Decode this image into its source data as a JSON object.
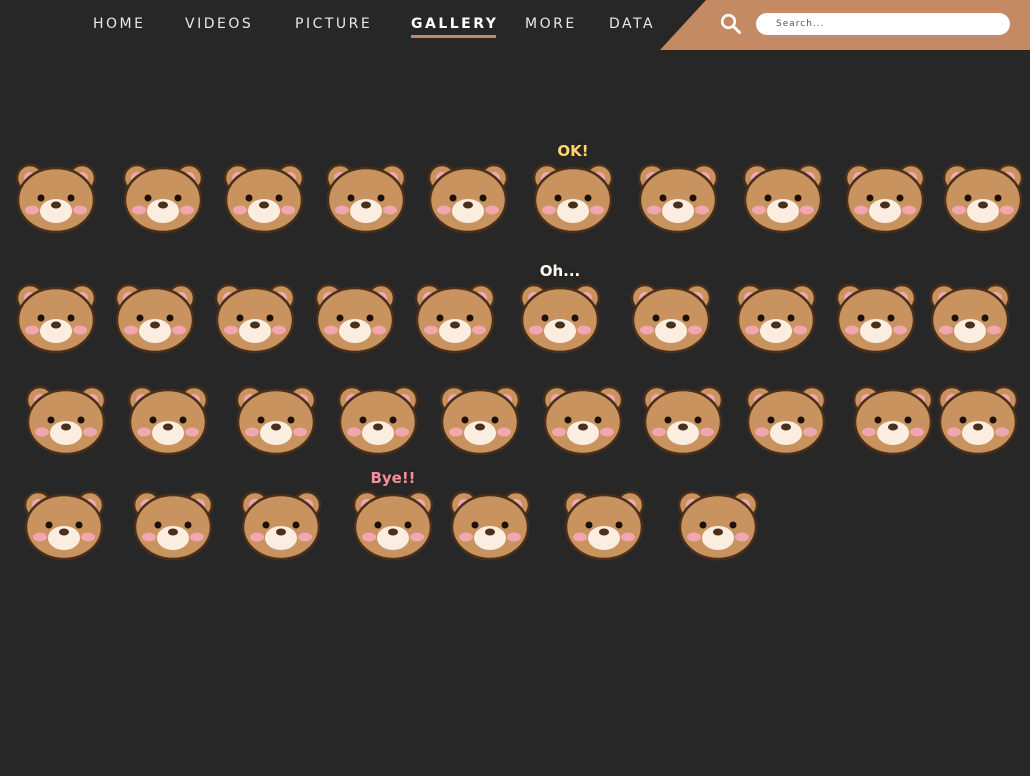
{
  "nav": {
    "items": [
      {
        "label": "HOME",
        "active": false
      },
      {
        "label": "VIDEOS",
        "active": false
      },
      {
        "label": "PICTURE",
        "active": false
      },
      {
        "label": "GALLERY",
        "active": true
      },
      {
        "label": "MORE",
        "active": false
      },
      {
        "label": "DATA",
        "active": false
      }
    ],
    "accent_color": "#c48a63"
  },
  "search": {
    "placeholder": "Search...",
    "value": "",
    "icon": "search-icon"
  },
  "colors": {
    "background": "#272727",
    "bear_fur": "#c9935f",
    "bear_outline": "#4a2f1a",
    "muzzle": "#fbeee0",
    "cheek": "#f2a6b0"
  },
  "gallery": {
    "stickers": [
      {
        "name": "sticker-bear-cheering",
        "caption": ""
      },
      {
        "name": "sticker-bear-giggling",
        "caption": ""
      },
      {
        "name": "sticker-bear-surprised",
        "caption": ""
      },
      {
        "name": "sticker-bear-thinking",
        "caption": ""
      },
      {
        "name": "sticker-bear-pompoms",
        "caption": ""
      },
      {
        "name": "sticker-bear-ok",
        "caption": "OK!"
      },
      {
        "name": "sticker-bear-hiding-face",
        "caption": ""
      },
      {
        "name": "sticker-bear-bowtie",
        "caption": ""
      },
      {
        "name": "sticker-bear-pink-bow",
        "caption": ""
      },
      {
        "name": "sticker-heart-bubble",
        "caption": ""
      },
      {
        "name": "sticker-bear-teary",
        "caption": ""
      },
      {
        "name": "sticker-bear-gloomy",
        "caption": ""
      },
      {
        "name": "sticker-bear-dark",
        "caption": ""
      },
      {
        "name": "sticker-bear-dizzy",
        "caption": ""
      },
      {
        "name": "sticker-bear-crying",
        "caption": ""
      },
      {
        "name": "sticker-bear-oh",
        "caption": "Oh..."
      },
      {
        "name": "sticker-bear-devil",
        "caption": ""
      },
      {
        "name": "sticker-bear-whistle",
        "caption": ""
      },
      {
        "name": "sticker-bear-sweat",
        "caption": ""
      },
      {
        "name": "sticker-bear-driving",
        "caption": ""
      },
      {
        "name": "sticker-bear-train",
        "caption": ""
      },
      {
        "name": "sticker-airplane",
        "caption": ""
      },
      {
        "name": "sticker-bear-glasses",
        "caption": ""
      },
      {
        "name": "sticker-bear-camera",
        "caption": ""
      },
      {
        "name": "sticker-bear-lying",
        "caption": ""
      },
      {
        "name": "sticker-bear-bottle",
        "caption": ""
      },
      {
        "name": "sticker-bear-face-mask",
        "caption": ""
      },
      {
        "name": "sticker-bear-bathtub",
        "caption": ""
      },
      {
        "name": "sticker-umbrella-rain",
        "caption": ""
      },
      {
        "name": "sticker-sun-bear",
        "caption": ""
      },
      {
        "name": "sticker-bear-shell",
        "caption": ""
      },
      {
        "name": "sticker-bear-shadow",
        "caption": ""
      },
      {
        "name": "sticker-bear-paws",
        "caption": ""
      },
      {
        "name": "sticker-bear-bye",
        "caption": "Bye!!"
      },
      {
        "name": "sticker-bear-peek-left",
        "caption": ""
      },
      {
        "name": "sticker-bear-peek-right",
        "caption": ""
      },
      {
        "name": "sticker-balloons",
        "caption": ""
      }
    ]
  }
}
